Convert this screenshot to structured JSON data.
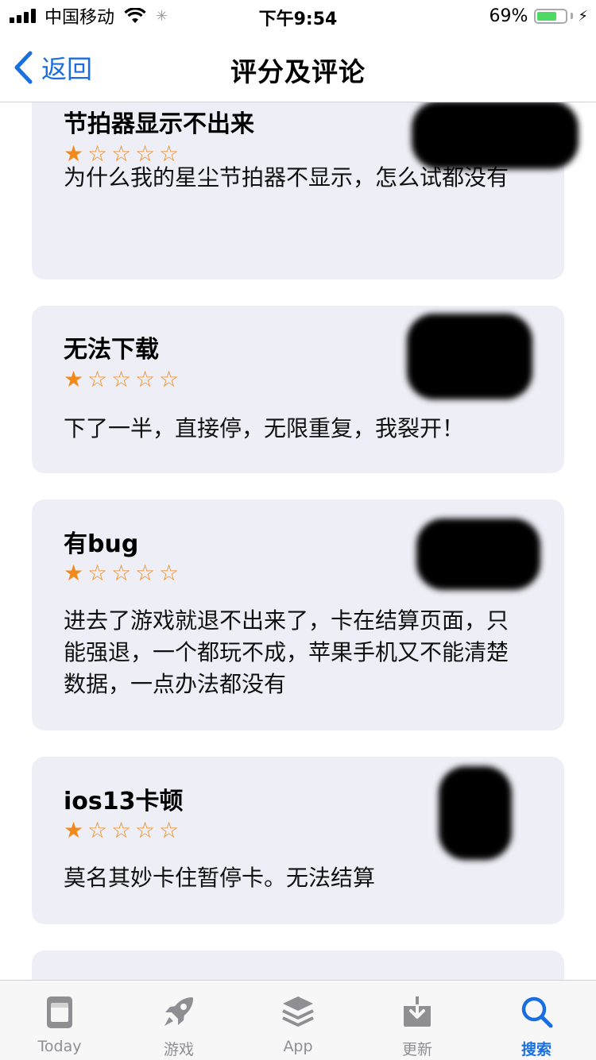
{
  "status_bar": {
    "carrier": "中国移动",
    "time": "下午9:54",
    "battery_percent": "69%",
    "battery_level": 0.69,
    "icons": [
      "signal-icon",
      "wifi-icon",
      "activity-icon",
      "battery-icon",
      "charging-icon"
    ]
  },
  "nav": {
    "back_label": "返回",
    "title": "评分及评论"
  },
  "reviews": [
    {
      "title": "节拍器显示不出来",
      "rating": 1,
      "max_rating": 5,
      "body": "为什么我的星尘节拍器不显示，怎么试都没有"
    },
    {
      "title": "无法下载",
      "rating": 1,
      "max_rating": 5,
      "body": "下了一半，直接停，无限重复，我裂开！"
    },
    {
      "title": "有bug",
      "rating": 1,
      "max_rating": 5,
      "body": "进去了游戏就退不出来了，卡在结算页面，只能强退，一个都玩不成，苹果手机又不能清楚数据，一点办法都没有"
    },
    {
      "title": "ios13卡顿",
      "rating": 1,
      "max_rating": 5,
      "body": "莫名其妙卡住暂停卡。无法结算"
    }
  ],
  "partial_review_hint": "",
  "tabs": [
    {
      "label": "Today",
      "icon": "today-icon",
      "active": false
    },
    {
      "label": "游戏",
      "icon": "rocket-icon",
      "active": false
    },
    {
      "label": "App",
      "icon": "layers-icon",
      "active": false
    },
    {
      "label": "更新",
      "icon": "download-icon",
      "active": false
    },
    {
      "label": "搜索",
      "icon": "search-icon",
      "active": true
    }
  ],
  "colors": {
    "accent": "#1a6fe0",
    "star": "#f08a1c",
    "card_bg": "#eeeef6",
    "battery": "#4cd964"
  }
}
